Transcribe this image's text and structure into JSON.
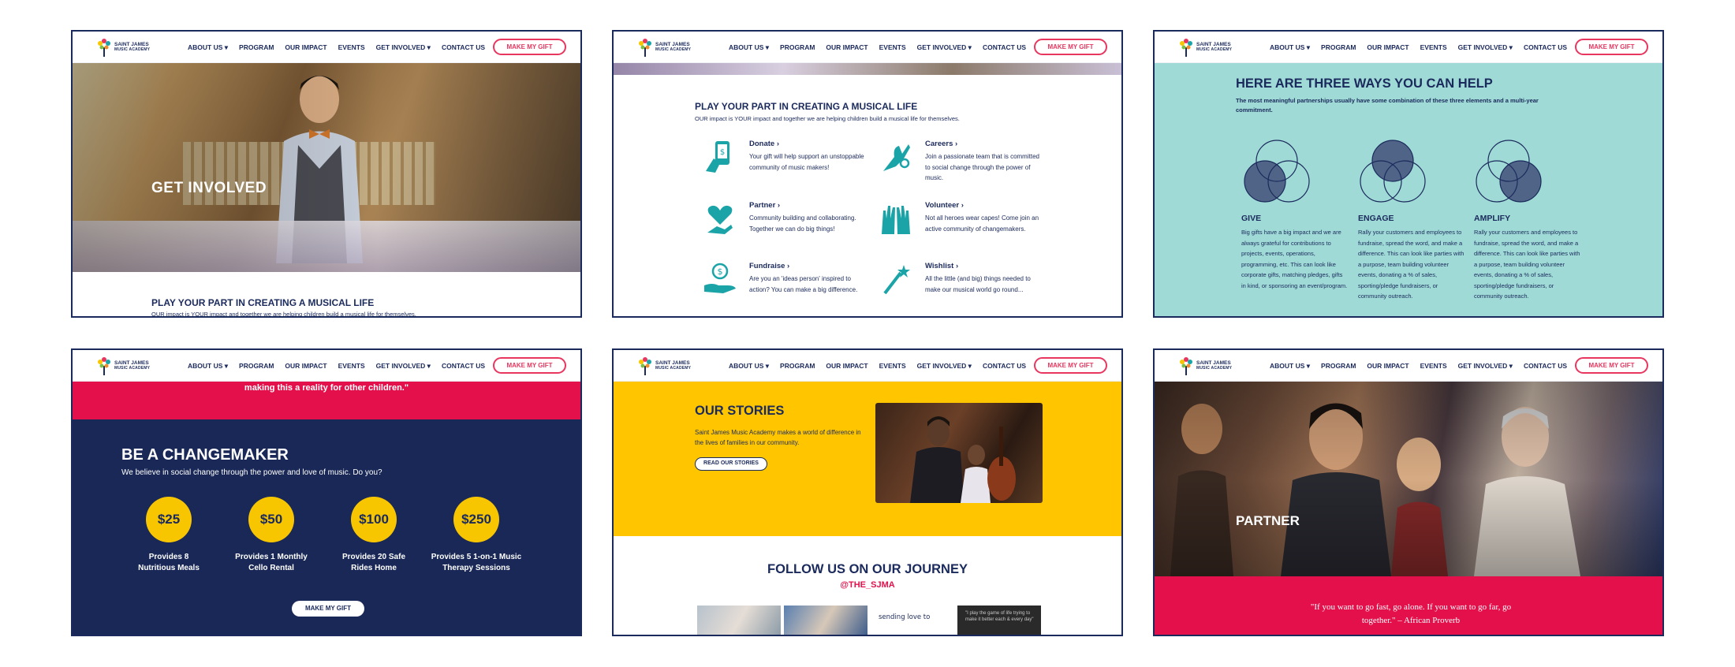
{
  "nav": {
    "logo_line1": "SAINT JAMES",
    "logo_line2": "MUSIC ACADEMY",
    "items": [
      "ABOUT US ▾",
      "PROGRAM",
      "OUR IMPACT",
      "EVENTS",
      "GET INVOLVED ▾",
      "CONTACT US"
    ],
    "gift_button": "MAKE MY GIFT"
  },
  "frame1": {
    "hero_label": "GET INVOLVED",
    "heading": "PLAY YOUR PART IN CREATING A MUSICAL LIFE",
    "subtext": "OUR impact is YOUR impact and together we are helping children build a musical life for themselves."
  },
  "frame2": {
    "heading": "PLAY YOUR PART IN CREATING A MUSICAL LIFE",
    "subtext": "OUR impact is YOUR impact and together we are helping children build a musical life for themselves.",
    "ways": [
      {
        "title": "Donate ›",
        "text": "Your gift will help support an unstoppable community of music makers!",
        "icon": "phone-donate-icon"
      },
      {
        "title": "Careers ›",
        "text": "Join a passionate team that is committed to social change through the power of music.",
        "icon": "ok-hand-icon"
      },
      {
        "title": "Partner ›",
        "text": "Community building and collaborating. Together we can do big things!",
        "icon": "heart-hand-icon"
      },
      {
        "title": "Volunteer ›",
        "text": "Not all heroes wear capes! Come join an active community of changemakers.",
        "icon": "raised-hands-icon"
      },
      {
        "title": "Fundraise ›",
        "text": "Are you an 'ideas person' inspired to action? You can make a big difference.",
        "icon": "coin-hand-icon"
      },
      {
        "title": "Wishlist ›",
        "text": "All the little (and big) things needed to make our musical world go round...",
        "icon": "magic-wand-icon"
      }
    ]
  },
  "frame3": {
    "heading": "HERE ARE THREE WAYS YOU CAN HELP",
    "subtext": "The most meaningful partnerships usually have some combination of these three elements and a multi-year commitment.",
    "columns": [
      {
        "title": "GIVE",
        "text": "Big gifts have a big impact and we are always grateful for contributions to projects, events, operations, programming, etc. This can look like corporate gifts, matching pledges, gifts in kind, or sponsoring an event/program."
      },
      {
        "title": "ENGAGE",
        "text": "Rally your customers and employees to fundraise, spread the word, and make a difference. This can look like parties with a purpose, team building volunteer events, donating a % of sales, sporting/pledge fundraisers, or community outreach."
      },
      {
        "title": "AMPLIFY",
        "text": "Rally your customers and employees to fundraise, spread the word, and make a difference. This can look like parties with a purpose, team building volunteer events, donating a % of sales, sporting/pledge fundraisers, or community outreach."
      }
    ],
    "colors": {
      "bg": "#9fdad6",
      "fill": "#4f6486"
    }
  },
  "frame4": {
    "quote_tail": "making this a reality for other children.\"",
    "heading": "BE A CHANGEMAKER",
    "subtext": "We believe in social change through the power and love of music. Do you?",
    "amounts": [
      {
        "amount": "$25",
        "label1": "Provides 8",
        "label2": "Nutritious Meals"
      },
      {
        "amount": "$50",
        "label1": "Provides 1 Monthly",
        "label2": "Cello Rental"
      },
      {
        "amount": "$100",
        "label1": "Provides 20 Safe",
        "label2": "Rides Home"
      },
      {
        "amount": "$250",
        "label1": "Provides 5 1-on-1 Music",
        "label2": "Therapy Sessions"
      }
    ],
    "button": "MAKE MY GIFT"
  },
  "frame5": {
    "heading": "OUR STORIES",
    "text": "Saint James Music Academy makes a world of difference in the lives of families in our community.",
    "button": "READ OUR STORIES",
    "follow": "FOLLOW US ON OUR JOURNEY",
    "handle": "@THE_SJMA",
    "thumb_text": "sending love to",
    "thumb_quote": "\"I play the game of life trying to make it better each & every day\""
  },
  "frame6": {
    "hero_label": "PARTNER",
    "quote_line1": "\"If you want to go fast, go alone.  If you want to go far, go",
    "quote_line2": "together.\" – African Proverb"
  },
  "colors": {
    "navy": "#1b2a5c",
    "pink": "#e8365f",
    "red": "#e3104b",
    "yellow": "#ffc600",
    "teal": "#1aa4a8"
  }
}
